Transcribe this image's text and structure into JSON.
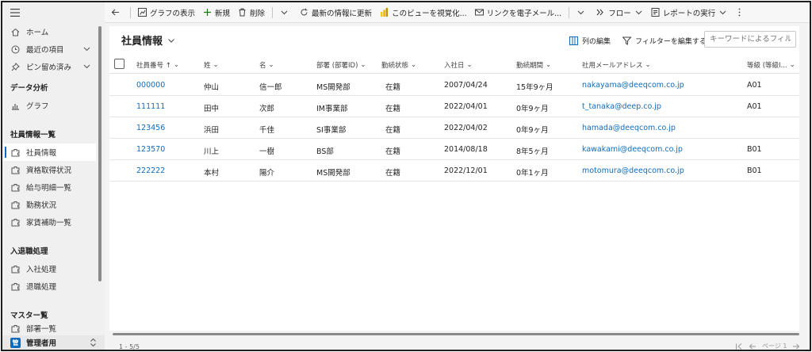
{
  "sidebar": {
    "menu_icon": "hamburger-icon",
    "items_top": [
      {
        "label": "ホーム",
        "icon": "home-icon"
      },
      {
        "label": "最近の項目",
        "icon": "clock-icon"
      },
      {
        "label": "ピン留め済み",
        "icon": "pin-icon"
      }
    ],
    "section_data_analysis": "データ分析",
    "graph_label": "グラフ",
    "section_employee": "社員情報一覧",
    "employee_items": [
      "社員情報",
      "資格取得状況",
      "給与明細一覧",
      "勤務状況",
      "家賃補助一覧"
    ],
    "section_onboarding": "入退職処理",
    "onboarding_items": [
      "入社処理",
      "退職処理"
    ],
    "section_master": "マスター覧",
    "master_items": [
      "部署一覧"
    ],
    "area_badge": "管",
    "area_label": "管理者用"
  },
  "commands": {
    "show_graph": "グラフの表示",
    "new": "新規",
    "delete": "削除",
    "refresh": "最新の情報に更新",
    "visualize": "このビューを視覚化...",
    "email_link": "リンクを電子メール...",
    "flow": "フロー",
    "run_report": "レポートの実行"
  },
  "view": {
    "title": "社員情報",
    "edit_columns": "列の編集",
    "edit_filters": "フィルターを編集する",
    "search_placeholder": "キーワードによるフィルタ",
    "columns": [
      "社員番号 ↑",
      "姓",
      "名",
      "部署 (部署ID)",
      "勤続状態",
      "入社日",
      "勤続期間",
      "社用メールアドレス",
      "等級 (等級I..."
    ],
    "rows": [
      {
        "id": "000000",
        "last": "仲山",
        "first": "信一郎",
        "dept": "MS開発部",
        "status": "在籍",
        "joined": "2007/04/24",
        "tenure": "15年9ヶ月",
        "email": "nakayama@deeqcom.co.jp",
        "grade": "A01"
      },
      {
        "id": "111111",
        "last": "田中",
        "first": "次郎",
        "dept": "IM事業部",
        "status": "在籍",
        "joined": "2022/04/01",
        "tenure": "0年9ヶ月",
        "email": "t_tanaka@deep.co.jp",
        "grade": "A01"
      },
      {
        "id": "123456",
        "last": "浜田",
        "first": "千佳",
        "dept": "SI事業部",
        "status": "在籍",
        "joined": "2022/04/02",
        "tenure": "0年9ヶ月",
        "email": "hamada@deeqcom.co.jp",
        "grade": ""
      },
      {
        "id": "123570",
        "last": "川上",
        "first": "一樹",
        "dept": "BS部",
        "status": "在籍",
        "joined": "2014/08/18",
        "tenure": "8年5ヶ月",
        "email": "kawakami@deeqcom.co.jp",
        "grade": "B01"
      },
      {
        "id": "222222",
        "last": "本村",
        "first": "陽介",
        "dept": "MS開発部",
        "status": "在籍",
        "joined": "2022/12/01",
        "tenure": "0年1ヶ月",
        "email": "motomura@deeqcom.co.jp",
        "grade": "B01"
      }
    ],
    "record_count": "1 - 5/5",
    "page_label": "ページ 1"
  },
  "colors": {
    "accent": "#0f6cbd",
    "sidebar_bg": "#f0f0f0",
    "link": "#0f6cbd"
  }
}
